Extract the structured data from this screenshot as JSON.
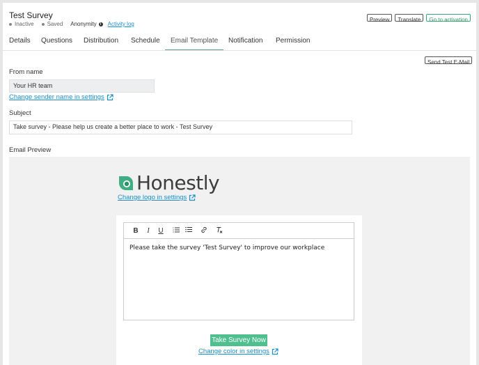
{
  "header": {
    "title": "Test Survey",
    "status_inactive": "Inactive",
    "status_saved": "Saved",
    "anonymity": "Anonymity",
    "activity_log": "Activity log"
  },
  "actions": {
    "preview": "Preview",
    "translate": "Translate",
    "activate": "Go to activation",
    "send_test": "Send Test E-Mail"
  },
  "tabs": [
    {
      "label": "Details"
    },
    {
      "label": "Questions"
    },
    {
      "label": "Distribution"
    },
    {
      "label": "Schedule"
    },
    {
      "label": "Email Template",
      "active": true
    },
    {
      "label": "Notification"
    },
    {
      "label": "Permission"
    }
  ],
  "form": {
    "from_name_label": "From name",
    "from_name_value": "Your HR team",
    "change_sender": "Change sender name in settings",
    "subject_label": "Subject",
    "subject_value": "Take survey - Please help us create a better place to work - Test Survey",
    "preview_label": "Email Preview"
  },
  "preview": {
    "logo_text": "Honestly",
    "change_logo": "Change logo in settings",
    "toolbar": [
      "B",
      "I",
      "U",
      "ordered-list-icon",
      "bullet-list-icon",
      "link-icon",
      "clear-format-icon"
    ],
    "body_text": "Please take the survey 'Test Survey' to improve our workplace",
    "cta_label": "Take Survey Now",
    "change_color": "Change color in settings"
  },
  "colors": {
    "accent": "#4fbf8f",
    "link": "#1b8fc9",
    "tab_underline": "#5aa38a"
  }
}
